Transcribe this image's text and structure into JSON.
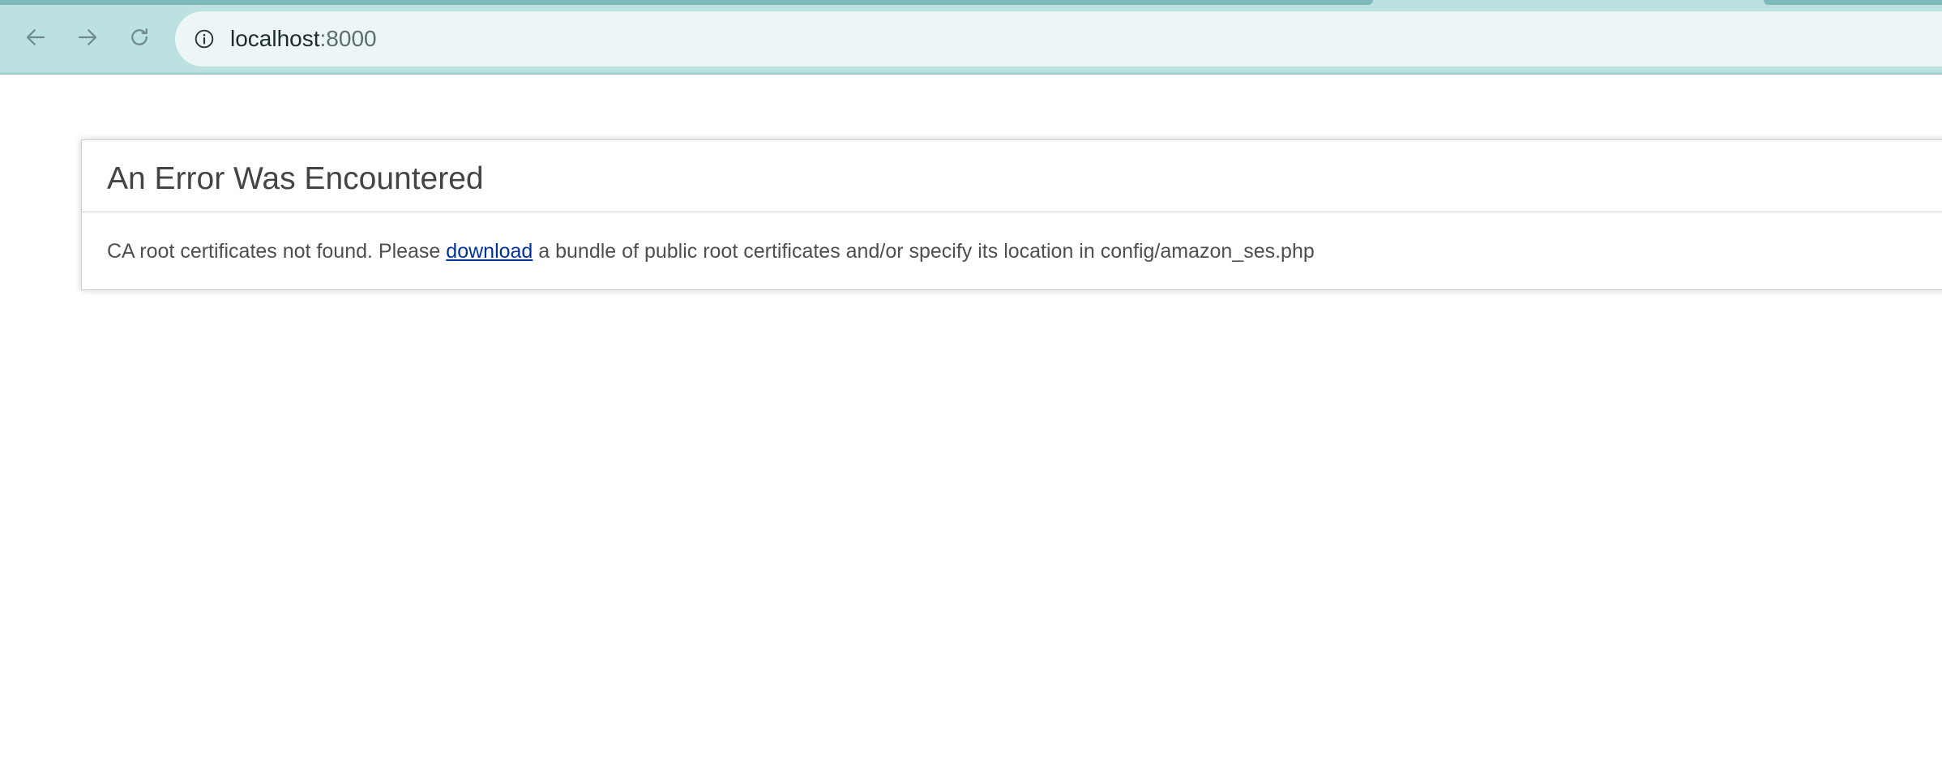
{
  "browser": {
    "url_host": "localhost",
    "url_port": ":8000",
    "icons": {
      "back": "arrow-left-icon",
      "forward": "arrow-right-icon",
      "reload": "reload-icon",
      "site_info": "info-icon"
    }
  },
  "error": {
    "title": "An Error Was Encountered",
    "message_before": "CA root certificates not found. Please ",
    "link_text": "download",
    "message_after": " a bundle of public root certificates and/or specify its location in config/amazon_ses.php"
  },
  "colors": {
    "chrome_bg": "#bde0e1",
    "address_bg": "#edf6f6",
    "link": "#003399",
    "title_text": "#444444"
  }
}
